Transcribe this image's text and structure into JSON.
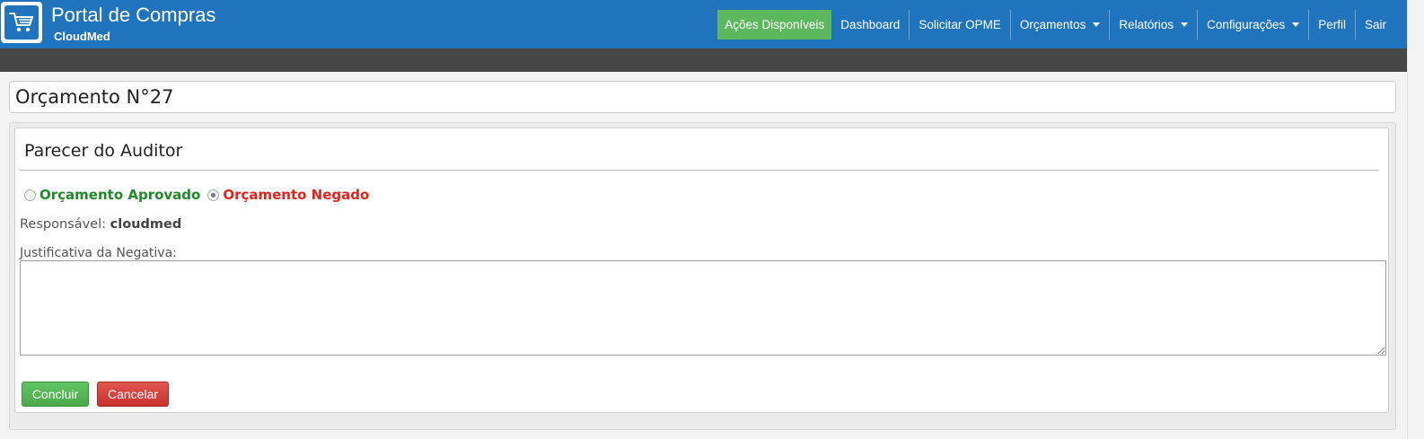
{
  "header": {
    "title": "Portal de Compras",
    "subtitle": "CloudMed",
    "logo_icon": "shopping-cart-icon",
    "bg_color": "#1f74bd"
  },
  "nav": {
    "actions": "Ações Disponíveis",
    "dashboard": "Dashboard",
    "solicitar": "Solicitar OPME",
    "orcamentos": "Orçamentos",
    "relatorios": "Relatórios",
    "configuracoes": "Configurações",
    "perfil": "Perfil",
    "sair": "Sair",
    "active_color": "#5cb85c"
  },
  "page": {
    "title": "Orçamento N°27"
  },
  "auditor": {
    "section_title": "Parecer do Auditor",
    "option_approved": "Orçamento Aprovado",
    "option_denied": "Orçamento Negado",
    "selected_option": "Orçamento Negado",
    "responsible_label": "Responsável:",
    "responsible_value": "cloudmed",
    "justification_label": "Justificativa da Negativa:",
    "justification_value": ""
  },
  "buttons": {
    "conclude": "Concluir",
    "cancel": "Cancelar"
  }
}
